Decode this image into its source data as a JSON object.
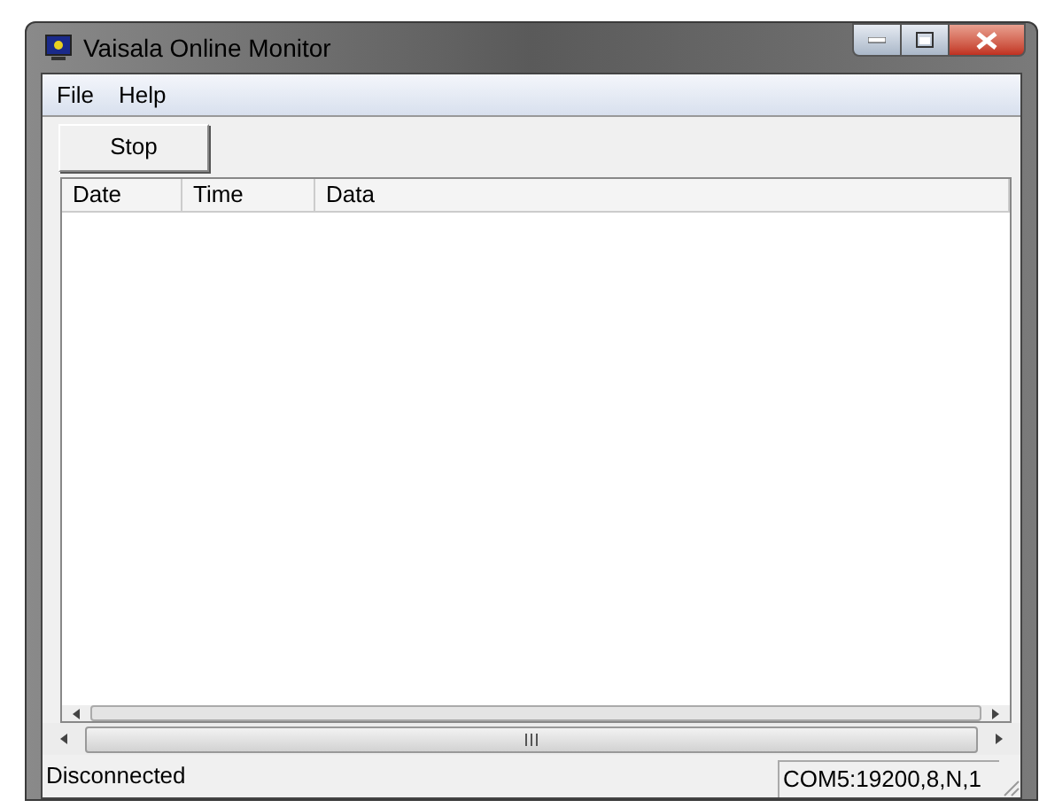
{
  "window": {
    "title": "Vaisala Online Monitor"
  },
  "menu": [
    "File",
    "Help"
  ],
  "toolbar": {
    "button": "Stop"
  },
  "table": {
    "columns": [
      "Date",
      "Time",
      "Data"
    ]
  },
  "status_bar": {
    "status": "Disconnected",
    "port": "COM5:19200,8,N,1"
  }
}
